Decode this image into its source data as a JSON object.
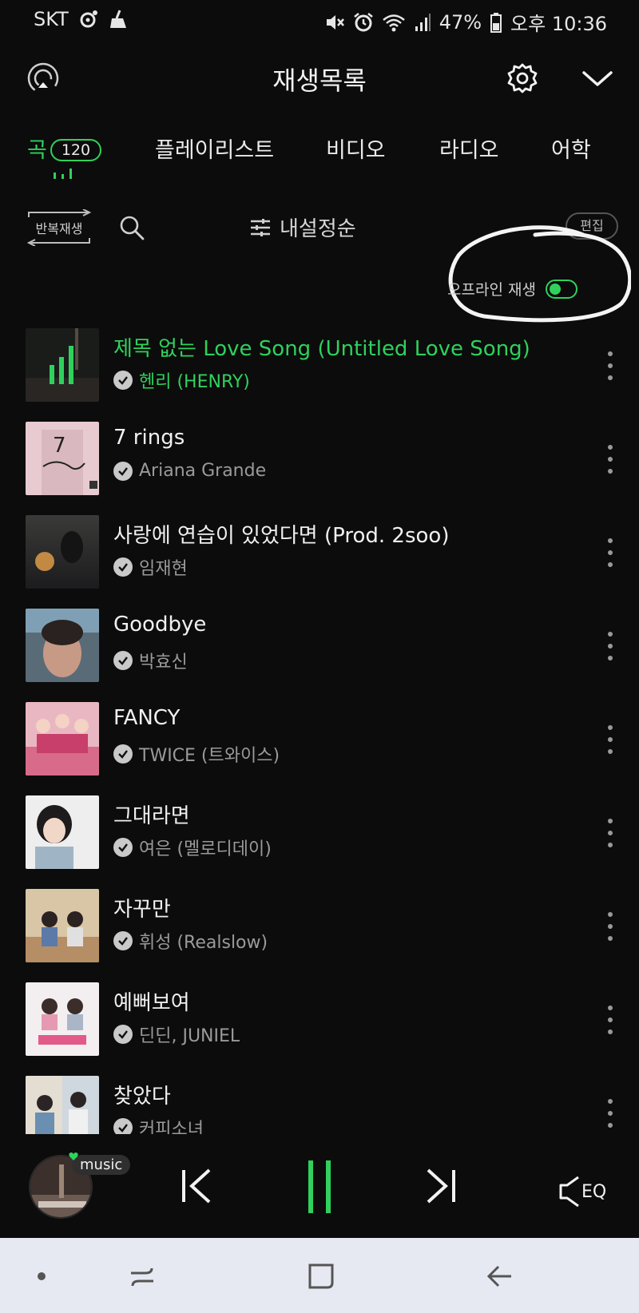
{
  "status_bar": {
    "carrier": "SKT",
    "battery": "47%",
    "time": "오후 10:36"
  },
  "header": {
    "title": "재생목록"
  },
  "tabs": [
    {
      "label": "곡",
      "badge": "120",
      "active": true
    },
    {
      "label": "플레이리스트"
    },
    {
      "label": "비디오"
    },
    {
      "label": "라디오"
    },
    {
      "label": "어학"
    }
  ],
  "controls": {
    "repeat_label": "반복재생",
    "sort_label": "내설정순",
    "edit_label": "편집"
  },
  "offline": {
    "label": "오프라인 재생",
    "enabled": true
  },
  "songs": [
    {
      "title": "제목 없는 Love Song (Untitled Love Song)",
      "artist": "헨리 (HENRY)",
      "playing": true
    },
    {
      "title": "7 rings",
      "artist": "Ariana Grande"
    },
    {
      "title": "사랑에 연습이 있었다면 (Prod. 2soo)",
      "artist": "임재현"
    },
    {
      "title": "Goodbye",
      "artist": "박효신"
    },
    {
      "title": "FANCY",
      "artist": "TWICE (트와이스)"
    },
    {
      "title": "그대라면",
      "artist": "여은 (멜로디데이)"
    },
    {
      "title": "자꾸만",
      "artist": "휘성 (Realslow)"
    },
    {
      "title": "예뻐보여",
      "artist": "딘딘, JUNIEL"
    },
    {
      "title": "찾았다",
      "artist": "커피소녀"
    }
  ],
  "player": {
    "badge": "music",
    "eq_label": "EQ"
  },
  "colors": {
    "accent": "#2fd15c",
    "background": "#0c0c0c",
    "navbar": "#e7e9f2"
  }
}
